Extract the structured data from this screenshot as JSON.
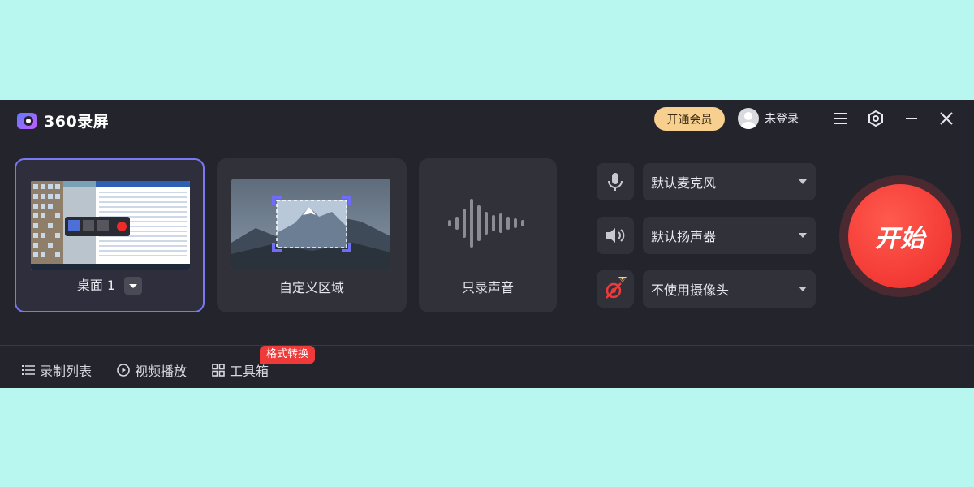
{
  "app": {
    "name": "360录屏"
  },
  "header": {
    "vip_label": "开通会员",
    "user_label": "未登录",
    "icons": [
      "menu-icon",
      "settings-icon",
      "minimize-icon",
      "close-icon"
    ]
  },
  "sources": [
    {
      "label": "桌面 1",
      "selected": true
    },
    {
      "label": "自定义区域",
      "selected": false
    },
    {
      "label": "只录声音",
      "selected": false
    }
  ],
  "devices": {
    "microphone": "默认麦克风",
    "speaker": "默认扬声器",
    "camera": "不使用摄像头"
  },
  "start_label": "开始",
  "bottom_nav": {
    "record_list": "录制列表",
    "video_play": "视频播放",
    "toolbox": "工具箱",
    "toolbox_badge": "格式转换"
  },
  "colors": {
    "page_background": "#b8f7f0",
    "app_background": "#24242c",
    "card_background": "#31313a",
    "selected_border": "#7a78f2",
    "vip": "#f7d08f",
    "start": "#ee2b2a",
    "badge": "#f03a3a"
  }
}
